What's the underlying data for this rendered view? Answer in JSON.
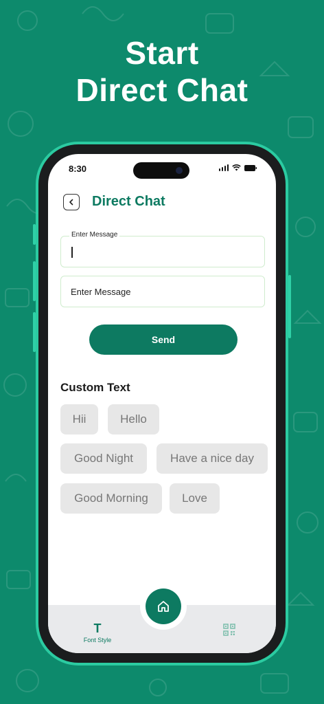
{
  "promo": {
    "line1": "Start",
    "line2": "Direct Chat"
  },
  "status_bar": {
    "time": "8:30",
    "icons": [
      "signal-icon",
      "wifi-icon",
      "battery-icon"
    ]
  },
  "header": {
    "back_icon": "chevron-left-icon",
    "title": "Direct Chat"
  },
  "form": {
    "message_field_label": "Enter Message",
    "message_field_value": "",
    "second_field_placeholder": "Enter Message",
    "send_label": "Send"
  },
  "custom_text": {
    "title": "Custom Text",
    "chips": [
      "Hii",
      "Hello",
      "Good Night",
      "Have a nice day",
      "Good Morning",
      "Love"
    ]
  },
  "bottom_nav": {
    "font_style_icon": "T",
    "font_style_label": "Font Style",
    "home_icon": "home-icon",
    "qr_icon": "qr-code-icon"
  },
  "colors": {
    "background": "#0d8a6c",
    "accent": "#0d7a61",
    "frame_glow": "#2fd1a7",
    "chip_bg": "#e7e7e7"
  }
}
